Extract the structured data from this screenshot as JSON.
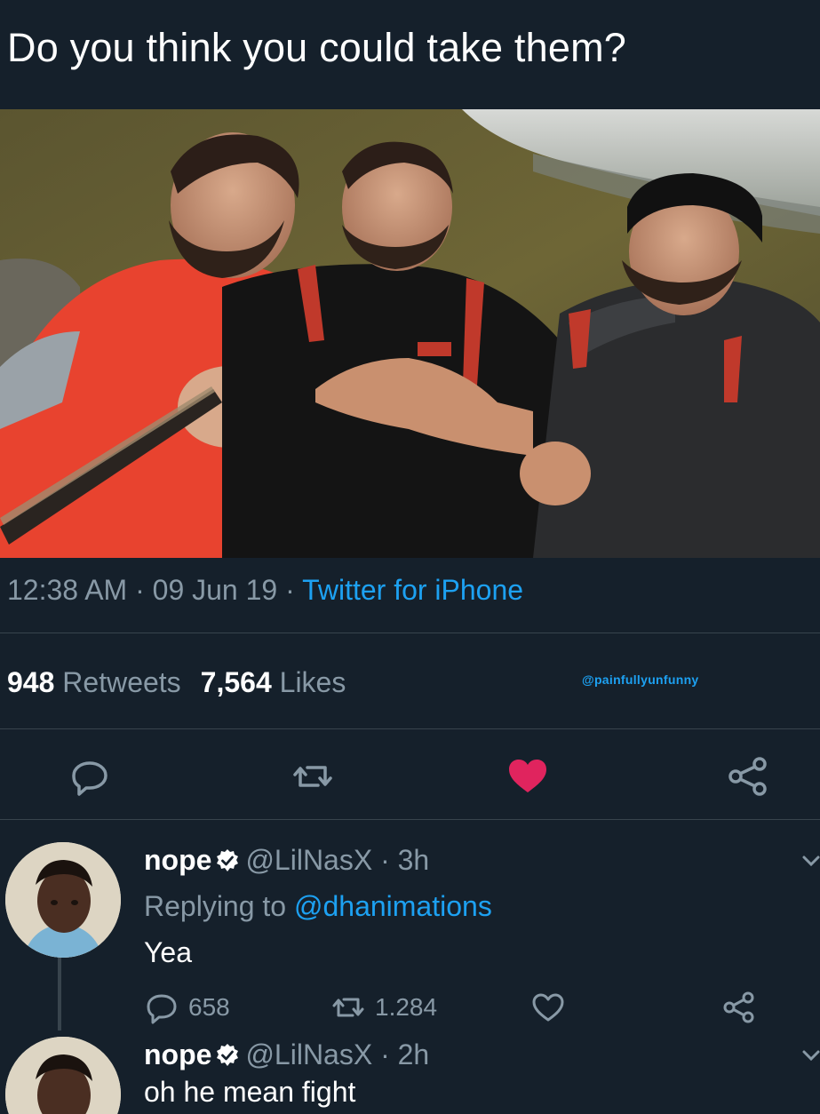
{
  "tweet": {
    "text": "Do you think you could take them?",
    "time": "12:38 AM",
    "sep1": " · ",
    "date": "09 Jun 19",
    "sep2": " · ",
    "source": "Twitter for iPhone",
    "retweets": "948",
    "retweets_label": "Retweets",
    "likes": "7,564",
    "likes_label": "Likes",
    "watermark": "@painfullyunfunny",
    "liked": true,
    "like_color": "#e0245e"
  },
  "actions": {
    "icons": [
      "reply-icon",
      "retweet-icon",
      "like-icon",
      "share-icon"
    ]
  },
  "replies": [
    {
      "name": "nope",
      "handle": "@LilNasX",
      "sep": " · ",
      "time": "3h",
      "replying_prefix": "Replying to ",
      "replying_to": "@dhanimations",
      "text": "Yea",
      "reply_count": "658",
      "retweet_count": "1.284"
    },
    {
      "name": "nope",
      "handle": "@LilNasX",
      "sep": " · ",
      "time": "2h",
      "text": "oh he mean fight"
    }
  ],
  "colors": {
    "background": "#15202b",
    "accent": "#1da1f2",
    "muted": "#8899a6",
    "like": "#e0245e"
  }
}
